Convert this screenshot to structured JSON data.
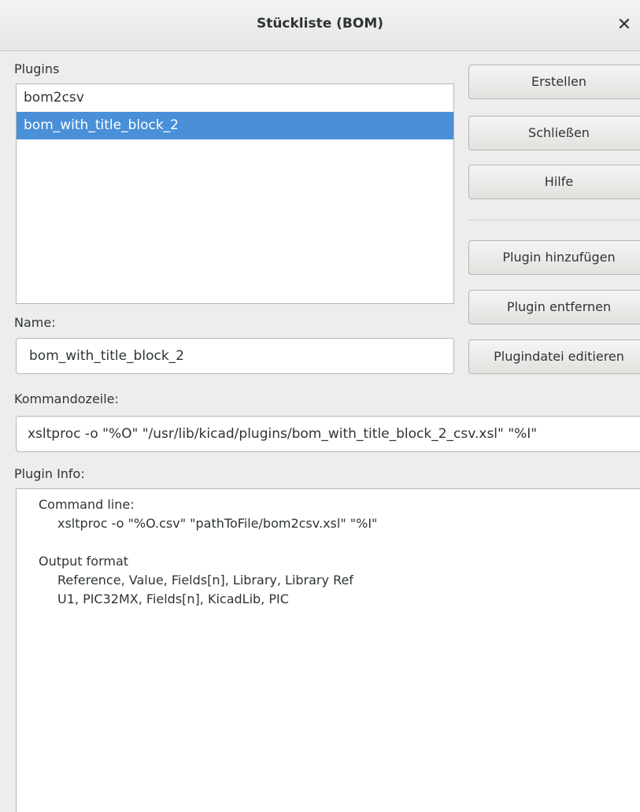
{
  "window": {
    "title": "Stückliste (BOM)",
    "close_glyph": "✕"
  },
  "plugins": {
    "label": "Plugins",
    "items": [
      {
        "label": "bom2csv",
        "selected": false
      },
      {
        "label": "bom_with_title_block_2",
        "selected": true
      }
    ]
  },
  "buttons": {
    "create": "Erstellen",
    "close": "Schließen",
    "help": "Hilfe",
    "add_plugin": "Plugin hinzufügen",
    "remove_plugin": "Plugin entfernen",
    "edit_plugin_file": "Plugindatei editieren"
  },
  "name": {
    "label": "Name:",
    "value": "bom_with_title_block_2"
  },
  "command": {
    "label": "Kommandozeile:",
    "value": "xsltproc -o \"%O\" \"/usr/lib/kicad/plugins/bom_with_title_block_2_csv.xsl\" \"%I\""
  },
  "plugin_info": {
    "label": "Plugin Info:",
    "lines": [
      {
        "text": "Command line:",
        "indent": false
      },
      {
        "text": "xsltproc -o \"%O.csv\" \"pathToFile/bom2csv.xsl\" \"%I\"",
        "indent": true
      },
      {
        "text": "",
        "indent": false
      },
      {
        "text": "Output format",
        "indent": false
      },
      {
        "text": "Reference, Value, Fields[n], Library, Library Ref",
        "indent": true
      },
      {
        "text": "U1, PIC32MX, Fields[n], KicadLib, PIC",
        "indent": true
      }
    ]
  },
  "colors": {
    "selection": "#4a90d9",
    "window_bg": "#ededed"
  }
}
